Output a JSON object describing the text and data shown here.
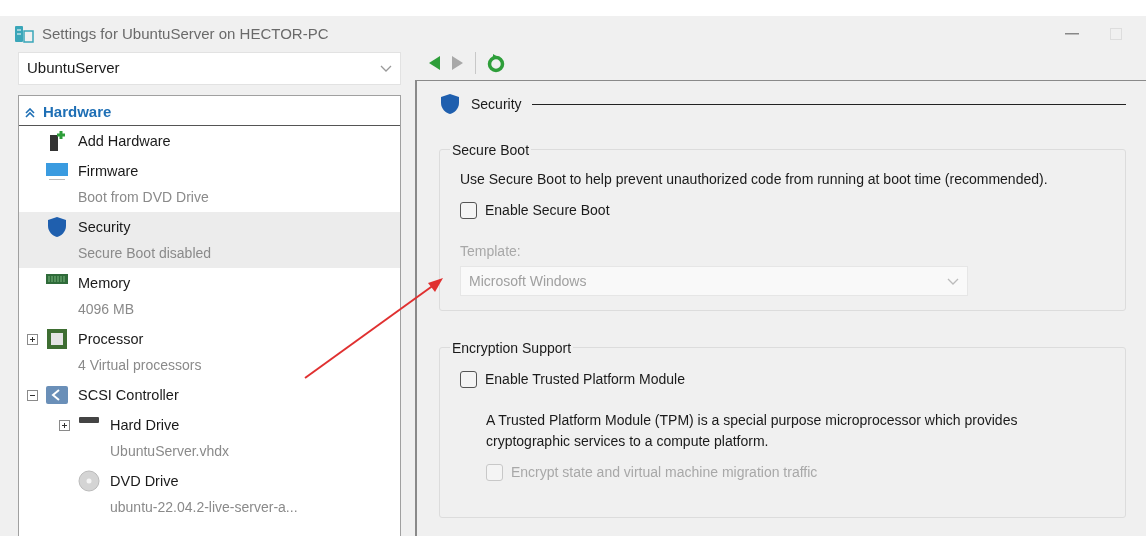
{
  "window": {
    "title": "Settings for UbuntuServer on HECTOR-PC"
  },
  "vm_selector": {
    "value": "UbuntuServer"
  },
  "nav_buttons": [
    {
      "kind": "back",
      "disabled": false
    },
    {
      "kind": "forward",
      "disabled": true
    },
    {
      "kind": "refresh",
      "disabled": false
    }
  ],
  "tree": {
    "header": "Hardware",
    "expanded": true,
    "items": [
      {
        "kind": "add-hardware",
        "label": "Add Hardware",
        "selected": false
      },
      {
        "kind": "firmware",
        "label": "Firmware",
        "detail": "Boot from DVD Drive",
        "selected": false
      },
      {
        "kind": "security",
        "label": "Security",
        "detail": "Secure Boot disabled",
        "selected": true
      },
      {
        "kind": "memory",
        "label": "Memory",
        "detail": "4096 MB",
        "selected": false
      },
      {
        "kind": "processor",
        "label": "Processor",
        "detail": "4 Virtual processors",
        "selected": false,
        "expanded": false
      },
      {
        "kind": "controller",
        "label": "SCSI Controller",
        "selected": false,
        "expanded": true,
        "children": [
          {
            "kind": "hard-drive",
            "label": "Hard Drive",
            "detail": "UbuntuServer.vhdx",
            "selected": false,
            "expanded": false
          },
          {
            "kind": "dvd",
            "label": "DVD Drive",
            "detail": "ubuntu-22.04.2-live-server-a...",
            "selected": false
          }
        ]
      }
    ]
  },
  "panel": {
    "title": "Security",
    "groups": [
      {
        "title": "Secure Boot",
        "fields": [
          {
            "kind": "description",
            "text": "Use Secure Boot to help prevent unauthorized code from running at boot time (recommended)."
          },
          {
            "kind": "checkbox",
            "label": "Enable Secure Boot",
            "checked": false,
            "disabled": false
          },
          {
            "kind": "select",
            "label": "Template:",
            "value": "Microsoft Windows",
            "disabled": true
          }
        ]
      },
      {
        "title": "Encryption Support",
        "fields": [
          {
            "kind": "checkbox",
            "label": "Enable Trusted Platform Module",
            "checked": false,
            "disabled": false
          },
          {
            "kind": "description",
            "text": "A Trusted Platform Module (TPM) is a special purpose microprocessor which provides cryptographic services to a compute platform."
          },
          {
            "kind": "checkbox",
            "label": "Encrypt state and virtual machine migration traffic",
            "checked": false,
            "disabled": true
          }
        ]
      }
    ]
  }
}
